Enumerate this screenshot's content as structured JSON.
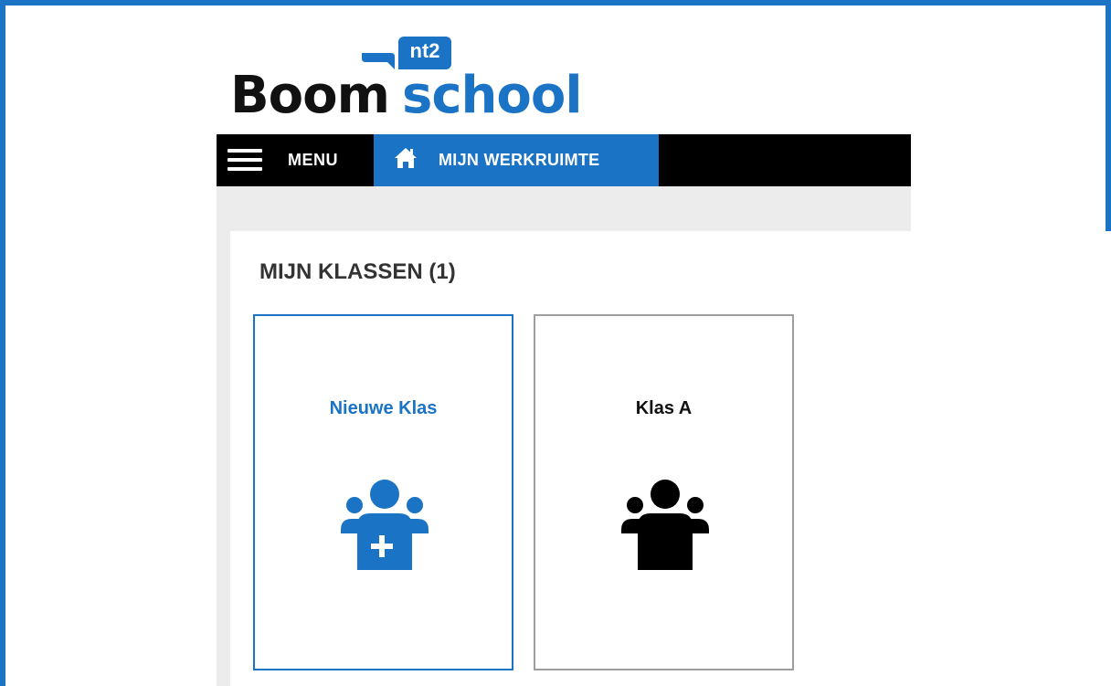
{
  "logo": {
    "brand_left": "Boom",
    "brand_right": "school",
    "badge": "nt2",
    "brand_color": "#1a73c4"
  },
  "nav": {
    "menu_label": "MENU",
    "menu_icon": "hamburger-icon",
    "home_tab_label": "MIJN WERKRUIMTE",
    "home_icon": "home-icon",
    "active_color": "#1a73c4"
  },
  "main": {
    "section_title": "MIJN KLASSEN (1)",
    "cards": [
      {
        "title": "Nieuwe Klas",
        "icon": "add-group-icon"
      },
      {
        "title": "Klas A",
        "icon": "group-icon"
      }
    ]
  }
}
